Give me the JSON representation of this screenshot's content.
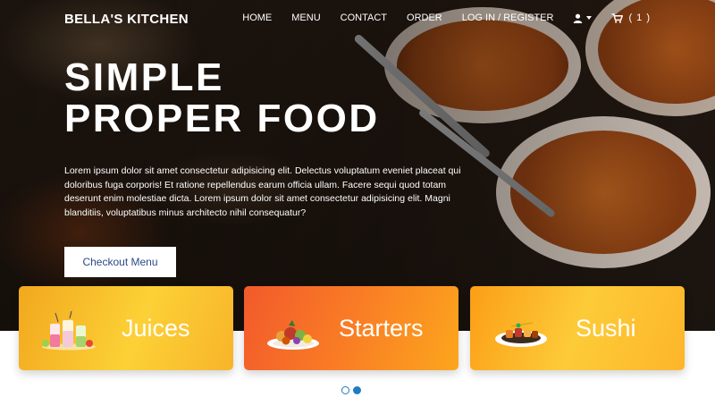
{
  "brand": "BELLA'S KITCHEN",
  "nav": {
    "links": [
      "HOME",
      "MENU",
      "CONTACT",
      "ORDER",
      "LOG IN / REGISTER"
    ],
    "user_icon": "user-icon",
    "cart_icon": "cart-icon",
    "cart_count": "( 1 )"
  },
  "hero": {
    "title_line1": "SIMPLE",
    "title_line2": "PROPER FOOD",
    "description": "Lorem ipsum dolor sit amet consectetur adipisicing elit. Delectus voluptatum eveniet placeat qui doloribus fuga corporis! Et ratione repellendus earum officia ullam. Facere sequi quod totam deserunt enim molestiae dicta. Lorem ipsum dolor sit amet consectetur adipisicing elit. Magni blanditiis, voluptatibus minus architecto nihil consequatur?",
    "cta_label": "Checkout Menu"
  },
  "categories": [
    {
      "label": "Juices",
      "icon": "juice-glasses-image"
    },
    {
      "label": "Starters",
      "icon": "starter-plate-image"
    },
    {
      "label": "Sushi",
      "icon": "sushi-plate-image"
    }
  ],
  "carousel": {
    "page_count": 2,
    "active_index": 1
  },
  "colors": {
    "accent_blue": "#1f7dc2",
    "button_text": "#2a4a88",
    "juices_card": "#fcd136",
    "starters_card": "#f97d25",
    "sushi_card": "#fdcb38"
  }
}
